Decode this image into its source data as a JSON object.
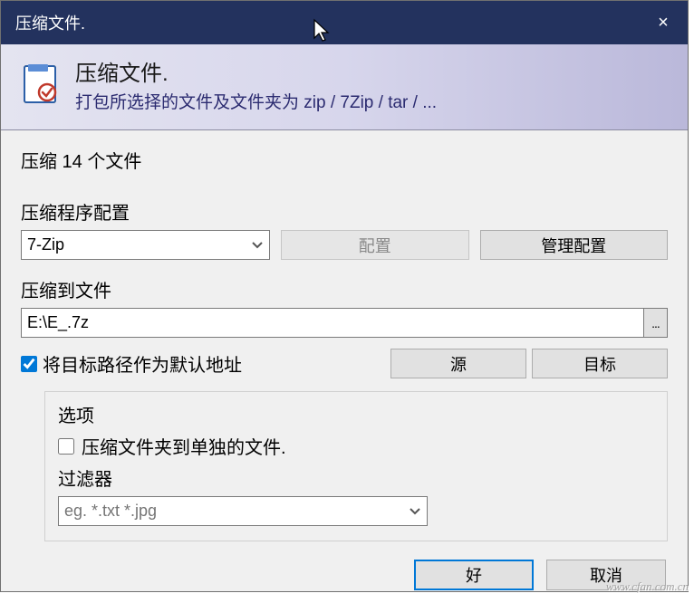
{
  "window": {
    "title": "压缩文件.",
    "close_icon": "×"
  },
  "header": {
    "title": "压缩文件.",
    "subtitle": "打包所选择的文件及文件夹为 zip / 7Zip / tar / ..."
  },
  "status": "压缩 14 个文件",
  "packer": {
    "label": "压缩程序配置",
    "selected": "7-Zip",
    "configure": "配置",
    "manage": "管理配置"
  },
  "target": {
    "label": "压缩到文件",
    "path": "E:\\E_.7z",
    "browse": "...",
    "default_path_label": "将目标路径作为默认地址",
    "default_path_checked": true,
    "source_btn": "源",
    "target_btn": "目标"
  },
  "options": {
    "group_label": "选项",
    "separate_label": "压缩文件夹到单独的文件.",
    "separate_checked": false,
    "filter_label": "过滤器",
    "filter_placeholder": "eg. *.txt *.jpg"
  },
  "footer": {
    "ok": "好",
    "cancel": "取消"
  },
  "watermark": "www.cfan.com.cn"
}
